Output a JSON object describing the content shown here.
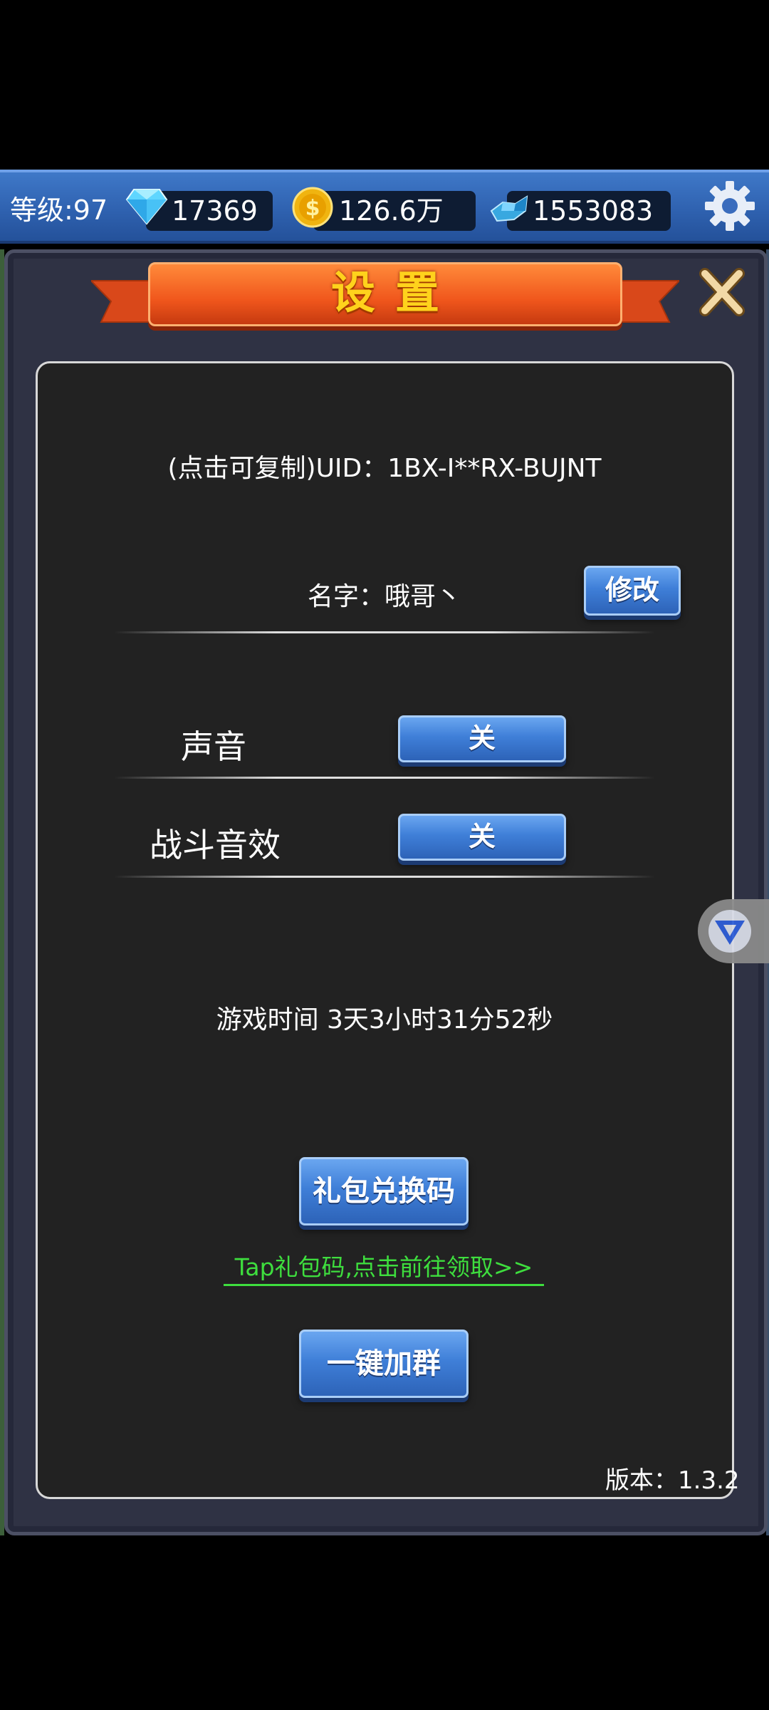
{
  "topbar": {
    "level": "等级:97",
    "diamonds": "17369",
    "gold": "126.6万",
    "ore": "1553083"
  },
  "dialog": {
    "title": "设置",
    "uid_text": "(点击可复制)UID：1BX-I**RX-BUJNT",
    "name_text": "名字：哦哥丶",
    "modify_label": "修改",
    "sound_label": "声音",
    "sound_value": "关",
    "battle_sfx_label": "战斗音效",
    "battle_sfx_value": "关",
    "play_time": "游戏时间 3天3小时31分52秒",
    "gift_code_label": "礼包兑换码",
    "tap_link": "Tap礼包码,点击前往领取>>",
    "join_group_label": "一键加群",
    "version": "版本：1.3.2"
  },
  "colors": {
    "title_text": "#ffd21c",
    "ribbon": "#f0561c",
    "link_green": "#3ede3e",
    "button_blue": "#3f7fd8"
  },
  "icons": {
    "diamond": "diamond-icon",
    "gold": "gold-coin-icon",
    "ore": "blue-ore-icon",
    "settings": "gear-icon",
    "close": "close-icon",
    "float": "v-logo-icon"
  }
}
